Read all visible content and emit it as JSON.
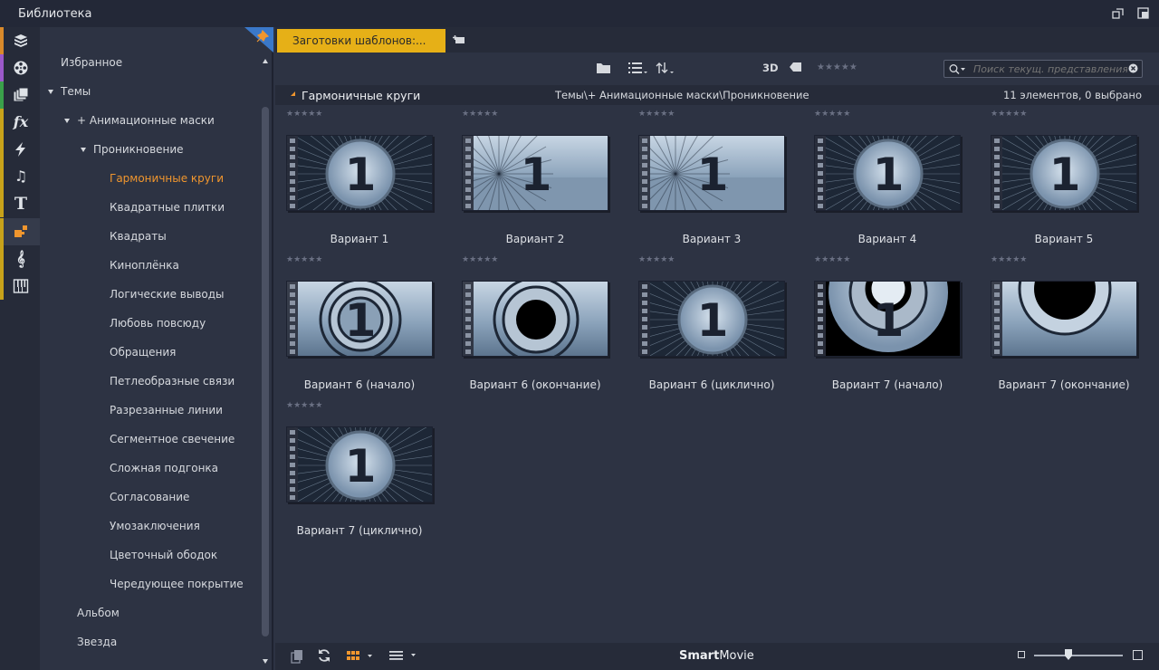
{
  "window": {
    "title": "Библиотека"
  },
  "strip": {
    "items": [
      {
        "icon": "box-icon",
        "color": "#d98a2b"
      },
      {
        "icon": "film-reel-icon",
        "color": "#9b59c9"
      },
      {
        "icon": "layers-icon",
        "color": "#3aa04a"
      },
      {
        "icon": "fx-icon",
        "color": "#c7a21a",
        "glyph": "fx"
      },
      {
        "icon": "bolt-icon",
        "color": "#c7a21a"
      },
      {
        "icon": "music-note-icon",
        "color": "#c7a21a",
        "glyph": "♫"
      },
      {
        "icon": "title-icon",
        "color": "#c7a21a",
        "glyph": "T"
      },
      {
        "icon": "template-icon",
        "color": "#c7a21a"
      },
      {
        "icon": "treble-clef-icon",
        "color": "#c7a21a",
        "glyph": "𝄞"
      },
      {
        "icon": "piano-icon",
        "color": "#c7a21a"
      }
    ]
  },
  "tree": {
    "items": [
      {
        "label": "Избранное",
        "level": 0,
        "expanded": null
      },
      {
        "label": "Темы",
        "level": 0,
        "expanded": true
      },
      {
        "label": "+ Анимационные маски",
        "level": 1,
        "expanded": true
      },
      {
        "label": "Проникновение",
        "level": 2,
        "expanded": true
      },
      {
        "label": "Гармоничные круги",
        "level": 3,
        "active": true
      },
      {
        "label": "Квадратные плитки",
        "level": 3
      },
      {
        "label": "Квадраты",
        "level": 3
      },
      {
        "label": "Киноплёнка",
        "level": 3
      },
      {
        "label": "Логические выводы",
        "level": 3
      },
      {
        "label": "Любовь повсюду",
        "level": 3
      },
      {
        "label": "Обращения",
        "level": 3
      },
      {
        "label": "Петлеобразные связи",
        "level": 3
      },
      {
        "label": "Разрезанные линии",
        "level": 3
      },
      {
        "label": "Сегментное свечение",
        "level": 3
      },
      {
        "label": "Сложная подгонка",
        "level": 3
      },
      {
        "label": "Согласование",
        "level": 3
      },
      {
        "label": "Умозаключения",
        "level": 3
      },
      {
        "label": "Цветочный ободок",
        "level": 3
      },
      {
        "label": "Чередующее покрытие",
        "level": 3
      },
      {
        "label": "Альбом",
        "level": 1
      },
      {
        "label": "Звезда",
        "level": 1
      }
    ]
  },
  "tabs": {
    "active_label": "Заготовки шаблонов:..."
  },
  "toolbar": {
    "mode_3d": "3D",
    "rating": "★★★★★",
    "search_placeholder": "Поиск текущ. представления"
  },
  "header": {
    "title": "Гармоничные круги",
    "path": "Темы\\+ Анимационные маски\\Проникновение",
    "count": "11 элементов, 0 выбрано"
  },
  "items": [
    {
      "label": "Вариант 1",
      "rating": "★★★★★"
    },
    {
      "label": "Вариант 2",
      "rating": "★★★★★"
    },
    {
      "label": "Вариант 3",
      "rating": "★★★★★"
    },
    {
      "label": "Вариант 4",
      "rating": "★★★★★"
    },
    {
      "label": "Вариант 5",
      "rating": "★★★★★"
    },
    {
      "label": "Вариант 6 (начало)",
      "rating": "★★★★★"
    },
    {
      "label": "Вариант 6 (окончание)",
      "rating": "★★★★★"
    },
    {
      "label": "Вариант 6 (циклично)",
      "rating": "★★★★★"
    },
    {
      "label": "Вариант 7 (начало)",
      "rating": "★★★★★"
    },
    {
      "label": "Вариант 7 (окончание)",
      "rating": "★★★★★"
    },
    {
      "label": "Вариант 7 (циклично)",
      "rating": "★★★★★"
    }
  ],
  "bottom": {
    "brand_bold": "Smart",
    "brand_light": "Movie"
  },
  "thumb_number": "1",
  "colors": {
    "accent_orange": "#f0962e",
    "tab_yellow": "#e6b017",
    "bg_panel": "#2d3343"
  }
}
